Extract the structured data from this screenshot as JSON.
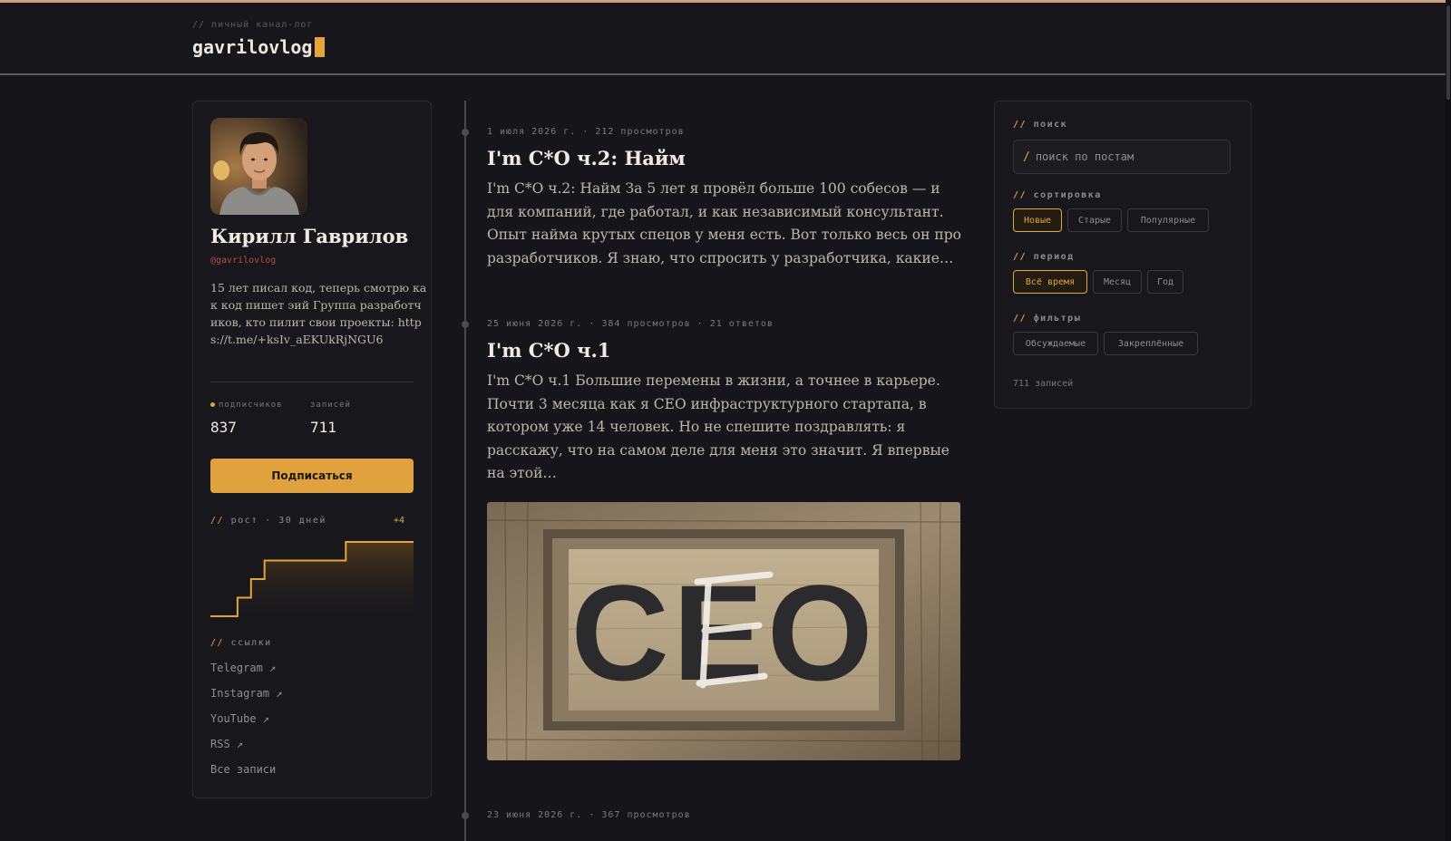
{
  "header": {
    "kicker": "// личный канал-лог",
    "brand": "gavrilovlog"
  },
  "profile": {
    "name": "Кирилл Гаврилов",
    "handle": "@gavrilovlog",
    "bio": "15 лет писал код, теперь смотрю как код пишет эий Группа разработчиков, кто пилит свои проекты: https://t.me/+ksIv_aEKUkRjNGU6",
    "stats": {
      "subscribers_label": "подписчиков",
      "subscribers": "837",
      "posts_label": "записей",
      "posts": "711"
    },
    "subscribe_label": "Подписаться",
    "growth": {
      "slashes": "//",
      "title": "рост · 30 дней",
      "delta": "+4",
      "values": [
        833,
        833,
        834,
        835,
        836,
        836,
        836,
        836,
        836,
        836,
        837,
        837,
        837,
        837,
        837,
        837
      ]
    },
    "links_slashes": "//",
    "links_title": "ссылки",
    "links": [
      "Telegram ↗",
      "Instagram ↗",
      "YouTube ↗",
      "RSS ↗",
      "Все записи"
    ]
  },
  "posts": [
    {
      "meta": "1 июля 2026 г. · 212 просмотров",
      "title": "I'm C*O ч.2: Найм",
      "body": "I'm C*O ч.2: Найм За 5 лет я провёл больше 100 собесов — и для компаний, где работал, и как независимый консультант. Опыт найма крутых спецов у меня есть. Вот только весь он про разработчиков. Я знаю, что спросить у разработчика, какие…"
    },
    {
      "meta": "25 июня 2026 г. · 384 просмотров · 21 ответов",
      "title": "I'm C*O ч.1",
      "body": "I'm C*O ч.1 Большие перемены в жизни, а точнее в карьере. Почти 3 месяца как я CEO инфраструктурного стартапа, в котором уже 14 человек. Но не спешите поздравлять: я расскажу, что на самом деле для меня это значит. Я впервые на этой…",
      "image_text": "CEO"
    },
    {
      "meta": "23 июня 2026 г. · 367 просмотров"
    }
  ],
  "sidebar": {
    "search_slashes": "//",
    "search_title": "поиск",
    "search_placeholder": "поиск по постам",
    "search_prefix": "/",
    "sort_slashes": "//",
    "sort_title": "сортировка",
    "sort_options": [
      "Новые",
      "Старые",
      "Популярные"
    ],
    "period_slashes": "//",
    "period_title": "период",
    "period_options": [
      "Всё время",
      "Месяц",
      "Год"
    ],
    "filters_slashes": "//",
    "filters_title": "фильтры",
    "filter_options": [
      "Обсуждаемые",
      "Закреплённые"
    ],
    "count": "711 записей"
  },
  "colors": {
    "accent": "#e3a53c",
    "background": "#16161a",
    "card": "#18181c",
    "handle": "#b04e43"
  }
}
